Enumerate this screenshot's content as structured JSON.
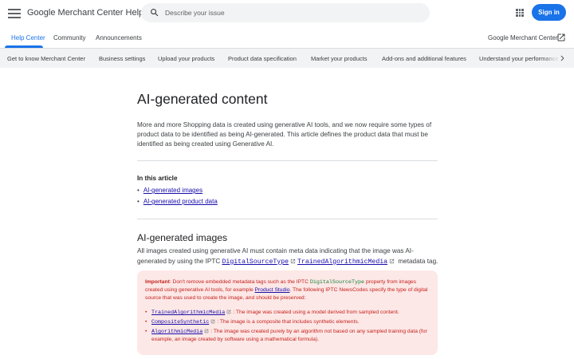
{
  "header": {
    "title": "Google Merchant Center Help",
    "search_placeholder": "Describe your issue",
    "signin_label": "Sign in"
  },
  "tabs": [
    {
      "label": "Help Center",
      "active": true
    },
    {
      "label": "Community",
      "active": false
    },
    {
      "label": "Announcements",
      "active": false
    }
  ],
  "product_link": "Google Merchant Center",
  "categories": [
    "Get to know Merchant Center",
    "Business settings",
    "Upload your products",
    "Product data specification",
    "Market your products",
    "Add-ons and additional features",
    "Understand your performance"
  ],
  "article": {
    "title": "AI-generated content",
    "intro": "More and more Shopping data is created using generative AI tools, and we now require some types of product data to be identified as being AI-generated. This article defines the product data that must be identified as being created using Generative AI.",
    "toc_title": "In this article",
    "toc": [
      "AI-generated images",
      "AI-generated product data"
    ],
    "section_title": "AI-generated images",
    "section_para_prefix": "All images created using generative AI must contain meta data indicating that the image was AI-generated by using the IPTC",
    "section_link_1": "DigitalSourceType",
    "section_link_2": "TrainedAlgorithmicMedia",
    "section_para_suffix": "metadata tag.",
    "callout": {
      "important_label": "Important",
      "text_1": ": Don't remove embedded metadata tags such as the IPTC",
      "code_1": "DigitalSourceType",
      "text_2": "property from images created using generative AI tools, for example",
      "link": "Product Studio",
      "text_3": ". The following IPTC NewsCodes specify the type of digital source that was used to create the image, and should be preserved:",
      "items": [
        {
          "code": "TrainedAlgorithmicMedia",
          "text": ": The image was created using a model derived from sampled content."
        },
        {
          "code": "CompositeSynthetic",
          "text": ": The image is a composite that includes synthetic elements."
        },
        {
          "code": "AlgorithmicMedia",
          "text": ": The image was created purely by an algorithm not based on any sampled training data (for example, an image created by software using a mathematical formula)."
        }
      ]
    }
  },
  "colors": {
    "accent": "#1a73e8",
    "callout_bg": "#fce8e6",
    "callout_text": "#c5221f",
    "code_green": "#188038"
  },
  "icons": [
    "menu-icon",
    "search-icon",
    "apps-grid-icon",
    "external-link-icon",
    "chevron-right-icon"
  ]
}
